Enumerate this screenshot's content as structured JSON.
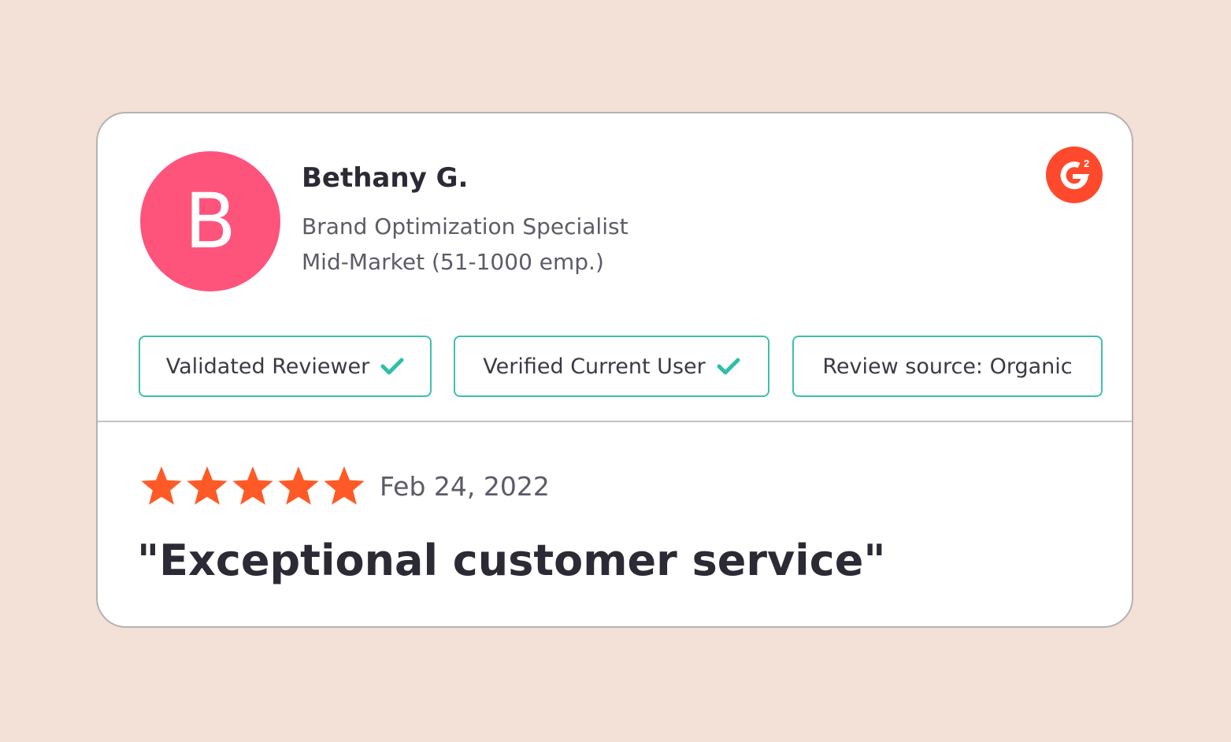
{
  "reviewer": {
    "initial": "B",
    "name": "Bethany G.",
    "role": "Brand Optimization Specialist",
    "segment": "Mid-Market (51-1000 emp.)"
  },
  "badges": [
    {
      "label": "Validated Reviewer",
      "icon": "check-icon"
    },
    {
      "label": "Verified Current User",
      "icon": "check-icon"
    },
    {
      "label": "Review source: Organic"
    }
  ],
  "review": {
    "rating": 5,
    "max_rating": 5,
    "date": "Feb 24, 2022",
    "title": "\"Exceptional customer service\""
  },
  "logo": {
    "icon": "g2-logo-icon"
  },
  "colors": {
    "background": "#f3e0d6",
    "avatar": "#fe547c",
    "badge_border": "#3fbfab",
    "check": "#2fbfa6",
    "star": "#ff5a26",
    "logo": "#ff492c"
  }
}
